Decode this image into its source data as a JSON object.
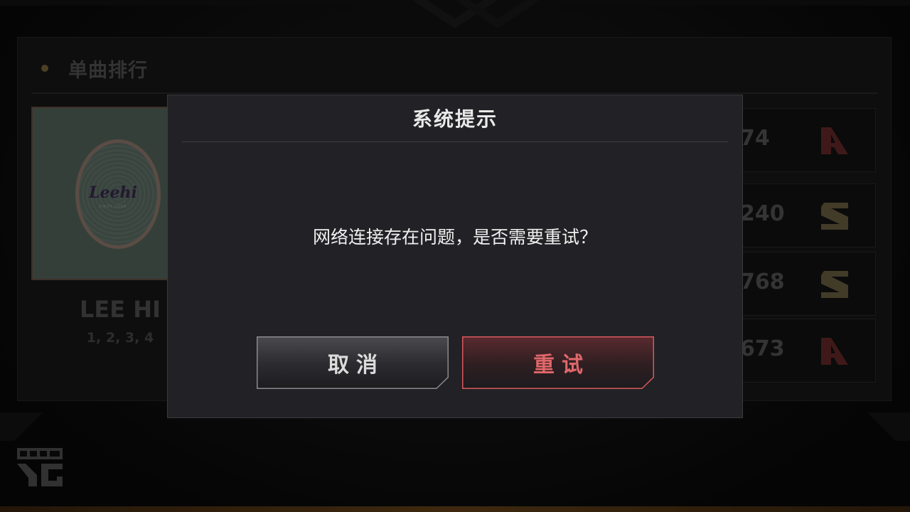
{
  "background": {
    "section_title": "单曲排行",
    "album": {
      "logo_text": "Leehi",
      "sub_text": "FIRST LOVE"
    },
    "artist": "LEE HI",
    "song": "1, 2, 3, 4",
    "scores": [
      {
        "value": "74",
        "grade": "A"
      },
      {
        "value": "240",
        "grade": "S"
      },
      {
        "value": "768",
        "grade": "S"
      },
      {
        "value": "673",
        "grade": "A"
      }
    ],
    "brand_logo": "BEAT YG"
  },
  "dialog": {
    "title": "系统提示",
    "message": "网络连接存在问题，是否需要重试？",
    "cancel_label": "取消",
    "retry_label": "重试"
  },
  "colors": {
    "dialog_bg": "#222226",
    "retry_accent": "#e0676a",
    "cancel_border": "#8a8a8e",
    "retry_border": "#d8585c"
  }
}
